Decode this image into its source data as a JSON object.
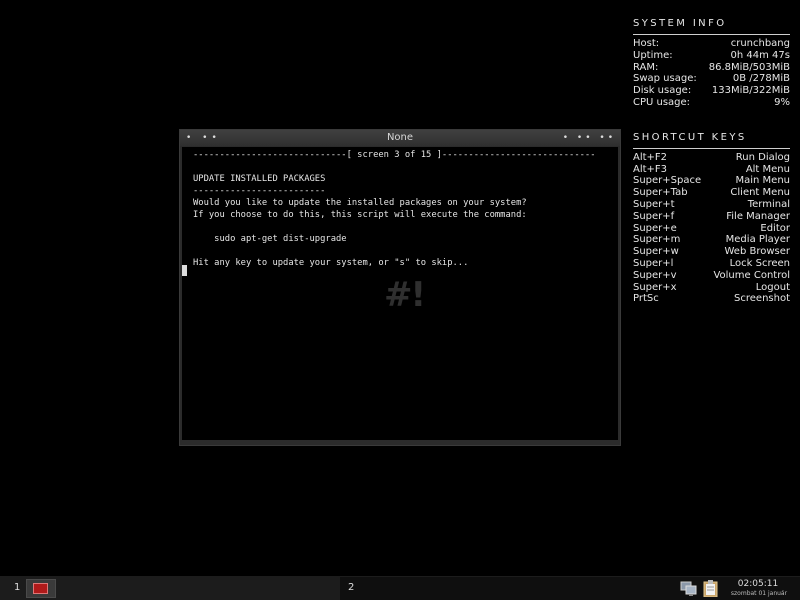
{
  "system_info": {
    "title": "SYSTEM INFO",
    "rows": [
      {
        "label": "Host:",
        "value": "crunchbang"
      },
      {
        "label": "Uptime:",
        "value": "0h 44m 47s"
      },
      {
        "label": "RAM:",
        "value": "86.8MiB/503MiB"
      },
      {
        "label": "Swap usage:",
        "value": "0B /278MiB"
      },
      {
        "label": "Disk usage:",
        "value": "133MiB/322MiB"
      },
      {
        "label": "CPU usage:",
        "value": "9%"
      }
    ]
  },
  "shortcut_keys": {
    "title": "SHORTCUT KEYS",
    "rows": [
      {
        "key": "Alt+F2",
        "action": "Run Dialog"
      },
      {
        "key": "Alt+F3",
        "action": "Alt Menu"
      },
      {
        "key": "Super+Space",
        "action": "Main Menu"
      },
      {
        "key": "Super+Tab",
        "action": "Client Menu"
      },
      {
        "key": "Super+t",
        "action": "Terminal"
      },
      {
        "key": "Super+f",
        "action": "File Manager"
      },
      {
        "key": "Super+e",
        "action": "Editor"
      },
      {
        "key": "Super+m",
        "action": "Media Player"
      },
      {
        "key": "Super+w",
        "action": "Web Browser"
      },
      {
        "key": "Super+l",
        "action": "Lock Screen"
      },
      {
        "key": "Super+v",
        "action": "Volume Control"
      },
      {
        "key": "Super+x",
        "action": "Logout"
      },
      {
        "key": "PrtSc",
        "action": "Screenshot"
      }
    ]
  },
  "window": {
    "title": "None",
    "left_buttons": "• ••",
    "right_buttons": "• •• ••",
    "lines": [
      "-----------------------------[ screen 3 of 15 ]-----------------------------",
      "",
      "UPDATE INSTALLED PACKAGES",
      "-------------------------",
      "Would you like to update the installed packages on your system?",
      "If you choose to do this, this script will execute the command:",
      "",
      "    sudo apt-get dist-upgrade",
      "",
      "Hit any key to update your system, or \"s\" to skip..."
    ],
    "logo_text": "#!"
  },
  "taskbar": {
    "desktop1": "1",
    "desktop2": "2",
    "clock_time": "02:05:11",
    "clock_date": "szombat 01 január"
  },
  "icons": {
    "task": "terminal-icon",
    "tray_network": "network-icon",
    "tray_clipboard": "clipboard-icon"
  }
}
